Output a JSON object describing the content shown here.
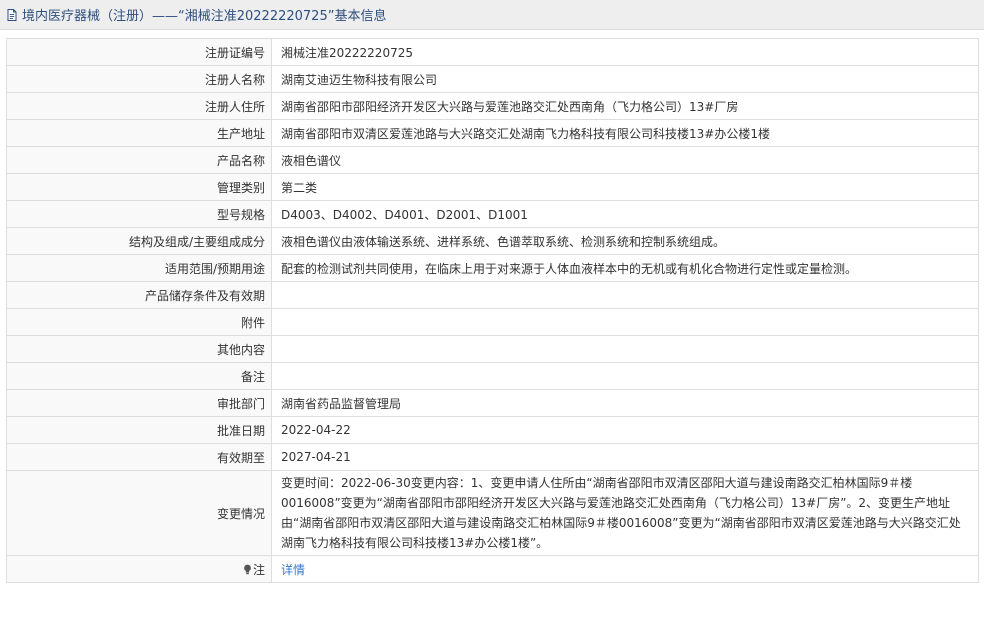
{
  "header": {
    "icon": "document-icon",
    "title": "境内医疗器械（注册）——“湘械注准20222220725”基本信息"
  },
  "rows": [
    {
      "label": "注册证编号",
      "value": "湘械注准20222220725"
    },
    {
      "label": "注册人名称",
      "value": "湖南艾迪迈生物科技有限公司"
    },
    {
      "label": "注册人住所",
      "value": "湖南省邵阳市邵阳经济开发区大兴路与爱莲池路交汇处西南角（飞力格公司）13#厂房"
    },
    {
      "label": "生产地址",
      "value": "湖南省邵阳市双清区爱莲池路与大兴路交汇处湖南飞力格科技有限公司科技楼13#办公楼1楼"
    },
    {
      "label": "产品名称",
      "value": "液相色谱仪"
    },
    {
      "label": "管理类别",
      "value": "第二类"
    },
    {
      "label": "型号规格",
      "value": "D4003、D4002、D4001、D2001、D1001"
    },
    {
      "label": "结构及组成/主要组成成分",
      "value": "液相色谱仪由液体输送系统、进样系统、色谱萃取系统、检测系统和控制系统组成。"
    },
    {
      "label": "适用范围/预期用途",
      "value": "配套的检测试剂共同使用，在临床上用于对来源于人体血液样本中的无机或有机化合物进行定性或定量检测。"
    },
    {
      "label": "产品储存条件及有效期",
      "value": ""
    },
    {
      "label": "附件",
      "value": ""
    },
    {
      "label": "其他内容",
      "value": ""
    },
    {
      "label": "备注",
      "value": ""
    },
    {
      "label": "审批部门",
      "value": "湖南省药品监督管理局"
    },
    {
      "label": "批准日期",
      "value": "2022-04-22"
    },
    {
      "label": "有效期至",
      "value": "2027-04-21"
    },
    {
      "label": "变更情况",
      "value": "变更时间：2022-06-30变更内容：1、变更申请人住所由“湖南省邵阳市双清区邵阳大道与建设南路交汇柏林国际9＃楼0016008”变更为“湖南省邵阳市邵阳经济开发区大兴路与爱莲池路交汇处西南角（飞力格公司）13#厂房”。2、变更生产地址由“湖南省邵阳市双清区邵阳大道与建设南路交汇柏林国际9＃楼0016008”变更为“湖南省邵阳市双清区爱莲池路与大兴路交汇处湖南飞力格科技有限公司科技楼13#办公楼1楼”。"
    }
  ],
  "note": {
    "icon": "lightbulb-icon",
    "label": "注",
    "link_text": "详情"
  },
  "colors": {
    "header_bg": "#eeeeee",
    "header_text": "#2f4f7f",
    "label_bg": "#f9f9f9",
    "border": "#dddddd",
    "link": "#3377cc"
  }
}
